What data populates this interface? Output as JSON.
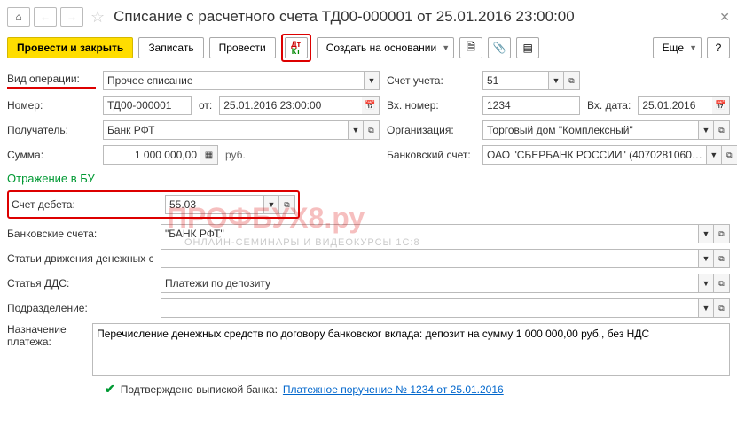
{
  "title": "Списание с расчетного счета ТД00-000001 от 25.01.2016 23:00:00",
  "toolbar": {
    "post_close": "Провести и закрыть",
    "save": "Записать",
    "post": "Провести",
    "create_based": "Создать на основании",
    "more": "Еще"
  },
  "fields": {
    "operation_type_label": "Вид операции:",
    "operation_type": "Прочее списание",
    "account_label": "Счет учета:",
    "account": "51",
    "number_label": "Номер:",
    "number": "ТД00-000001",
    "from_label": "от:",
    "date": "25.01.2016 23:00:00",
    "in_number_label": "Вх. номер:",
    "in_number": "1234",
    "in_date_label": "Вх. дата:",
    "in_date": "25.01.2016",
    "recipient_label": "Получатель:",
    "recipient": "Банк РФТ",
    "org_label": "Организация:",
    "org": "Торговый дом \"Комплексный\"",
    "sum_label": "Сумма:",
    "sum": "1 000 000,00",
    "currency": "руб.",
    "bank_account_label": "Банковский счет:",
    "bank_account": "ОАО \"СБЕРБАНК РОССИИ\" (4070281060…"
  },
  "section_bu": "Отражение в БУ",
  "bu": {
    "debit_account_label": "Счет дебета:",
    "debit_account": "55.03",
    "bank_accounts_label": "Банковские счета:",
    "bank_accounts": "\"БАНК РФТ\"",
    "cash_flow_label": "Статьи движения денежных ср...",
    "dds_label": "Статья ДДС:",
    "dds": "Платежи по депозиту",
    "division_label": "Подразделение:"
  },
  "payment": {
    "purpose_label": "Назначение платежа:",
    "purpose": "Перечисление денежных средств по договору банковског вклада: депозит на сумму 1 000 000,00 руб., без НДС"
  },
  "confirm": {
    "label": "Подтверждено выпиской банка:",
    "link": "Платежное поручение № 1234 от 25.01.2016"
  },
  "watermark": "ПРОФБУХ8.ру",
  "watermark_sub": "ОНЛАЙН-СЕМИНАРЫ И ВИДЕОКУРСЫ 1С:8"
}
